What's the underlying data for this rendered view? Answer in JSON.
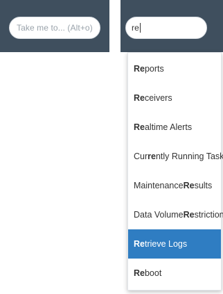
{
  "left_search": {
    "placeholder": "Take me to... (Alt+o)"
  },
  "right_search": {
    "value": "re"
  },
  "dropdown": {
    "active_index": 7,
    "items": [
      {
        "label": "Reports",
        "parts": [
          [
            "Re",
            true
          ],
          [
            "ports",
            false
          ]
        ]
      },
      {
        "label": "Receivers",
        "parts": [
          [
            "Re",
            true
          ],
          [
            "ceivers",
            false
          ]
        ]
      },
      {
        "label": "Realtime Alerts",
        "parts": [
          [
            "Re",
            true
          ],
          [
            "altime Alerts",
            false
          ]
        ]
      },
      {
        "label": "Currently Running Tasks",
        "parts": [
          [
            "Cur",
            false
          ],
          [
            "re",
            true
          ],
          [
            "ntly Running Tasks",
            false
          ]
        ]
      },
      {
        "label": "Maintenance Results",
        "parts": [
          [
            "Maintenance ",
            false
          ],
          [
            "Re",
            true
          ],
          [
            "sults",
            false
          ]
        ]
      },
      {
        "label": "Data Volume Restrictions",
        "parts": [
          [
            "Data Volume ",
            false
          ],
          [
            "Re",
            true
          ],
          [
            "strictions",
            false
          ]
        ]
      },
      {
        "label": "Retrieve Logs",
        "parts": [
          [
            "Re",
            true
          ],
          [
            "trieve Logs",
            false
          ]
        ]
      },
      {
        "label": "Reboot",
        "parts": [
          [
            "Re",
            true
          ],
          [
            "boot",
            false
          ]
        ]
      }
    ]
  },
  "colors": {
    "header_bg": "#3f4f5e",
    "active_bg": "#2f7dc2"
  }
}
